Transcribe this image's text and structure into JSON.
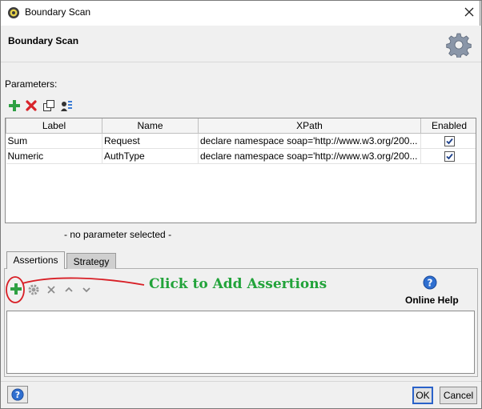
{
  "window": {
    "title": "Boundary Scan"
  },
  "header": {
    "title": "Boundary Scan"
  },
  "parameters": {
    "label": "Parameters:",
    "columns": [
      "Label",
      "Name",
      "XPath",
      "Enabled"
    ],
    "rows": [
      {
        "label": "Sum",
        "name": "Request",
        "xpath": "declare namespace soap='http://www.w3.org/200...",
        "enabled": true
      },
      {
        "label": "Numeric",
        "name": "AuthType",
        "xpath": "declare namespace soap='http://www.w3.org/200...",
        "enabled": true
      }
    ],
    "selection_status": "- no parameter selected -"
  },
  "tabs": [
    {
      "label": "Assertions",
      "active": true
    },
    {
      "label": "Strategy",
      "active": false
    }
  ],
  "assertions": {
    "annotation": "Click to Add Assertions",
    "online_help": "Online Help",
    "annotation_color": "#22a33a"
  },
  "footer": {
    "ok_label": "OK",
    "cancel_label": "Cancel"
  },
  "icons": {
    "add": "add-icon",
    "remove": "remove-icon",
    "clone": "clone-icon",
    "extract": "extract-icon",
    "configure": "gear-icon",
    "delete": "delete-icon",
    "move_up": "move-up-icon",
    "move_down": "move-down-icon",
    "help": "help-icon"
  }
}
